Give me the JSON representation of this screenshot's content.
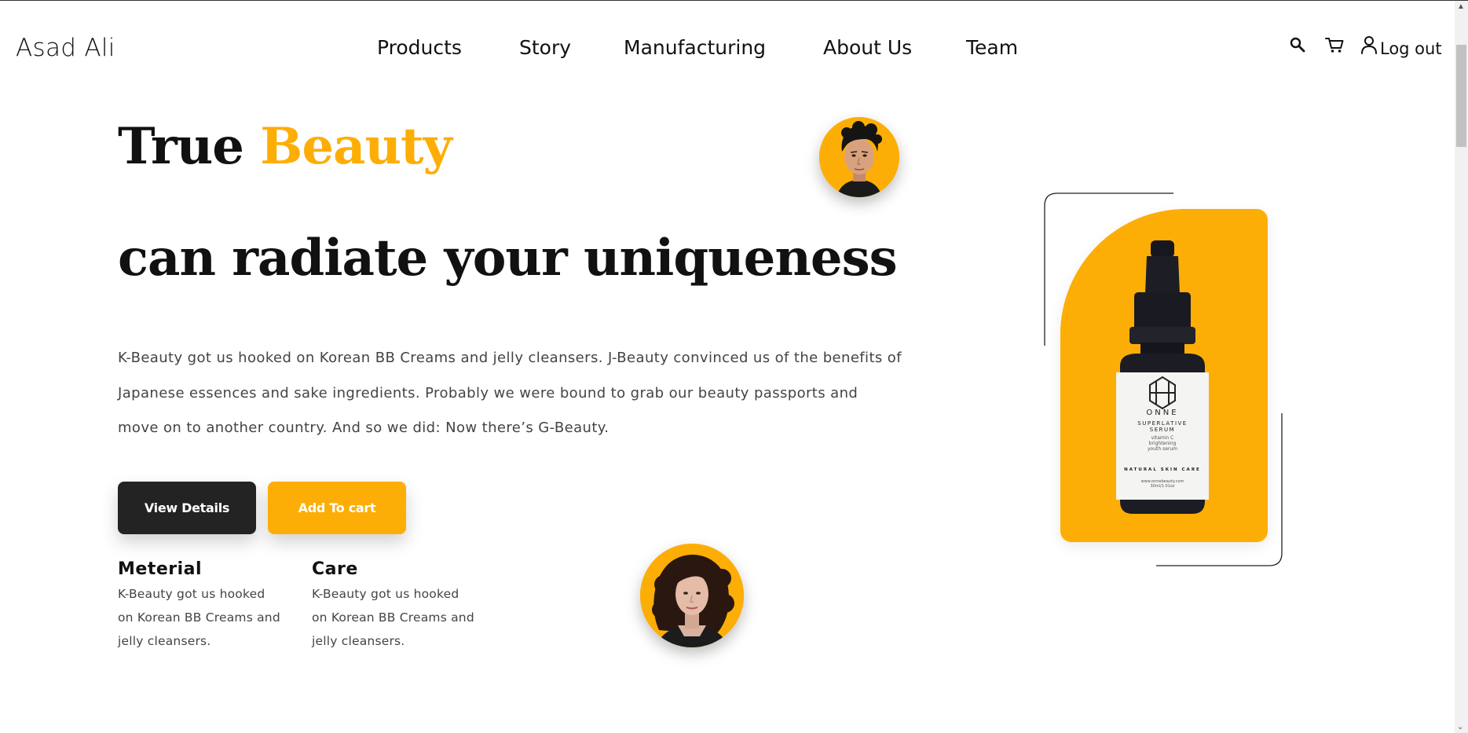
{
  "header": {
    "brand": "Asad Ali",
    "nav": [
      "Products",
      "Story",
      "Manufacturing",
      "About Us",
      "Team"
    ],
    "icons": [
      "search-icon",
      "cart-icon",
      "user-icon"
    ],
    "logout_label": "Log out"
  },
  "hero": {
    "title_part1": "True",
    "title_accent": "Beauty",
    "subtitle": "can radiate your uniqueness",
    "description": "K-Beauty got us hooked on Korean BB Creams and jelly cleansers. J-Beauty convinced us of the benefits of Japanese essences and sake ingredients. Probably we were bound to grab our beauty passports and move on to another country. And so we did: Now there’s G-Beauty.",
    "primary_button": "View Details",
    "secondary_button": "Add To cart"
  },
  "features": [
    {
      "title": "Meterial",
      "text": "K-Beauty got us hooked on Korean BB Creams and jelly cleansers."
    },
    {
      "title": "Care",
      "text": "K-Beauty got us hooked on Korean BB Creams and jelly cleansers."
    }
  ],
  "product": {
    "brand": "ONNE",
    "name_line1": "SUPERLATIVE",
    "name_line2": "SERUM",
    "detail_lines": [
      "vitamin C",
      "brightening",
      "youth serum"
    ],
    "tagline": "NATURAL SKIN CARE",
    "site": "www.onnebeauty.com",
    "volume": "30ml/1.01oz"
  },
  "colors": {
    "accent": "#fdae06",
    "dark": "#232323",
    "text": "#111111",
    "muted": "#444444"
  }
}
